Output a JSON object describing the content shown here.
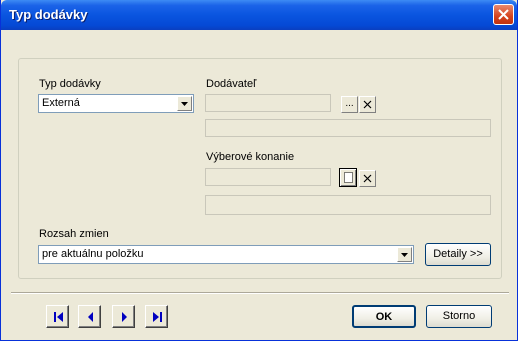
{
  "window": {
    "title": "Typ dodávky",
    "titlebar_color": "#0a55e0",
    "close_icon": "close-icon"
  },
  "form": {
    "delivery_type": {
      "label": "Typ dodávky",
      "value": "Externá"
    },
    "supplier": {
      "label": "Dodávateľ",
      "browse_label": "...",
      "clear_icon": "clear-icon"
    },
    "procurement": {
      "label": "Výberové konanie",
      "browse_icon": "document-icon",
      "clear_icon": "clear-icon"
    },
    "scope": {
      "label": "Rozsah zmien",
      "value": "pre aktuálnu položku"
    },
    "details_button": "Detaily >>"
  },
  "navigation": {
    "buttons": [
      "first-record-icon",
      "previous-record-icon",
      "next-record-icon",
      "last-record-icon"
    ],
    "icon_color": "#0000c0"
  },
  "actions": {
    "ok_label": "OK",
    "cancel_label": "Storno"
  }
}
